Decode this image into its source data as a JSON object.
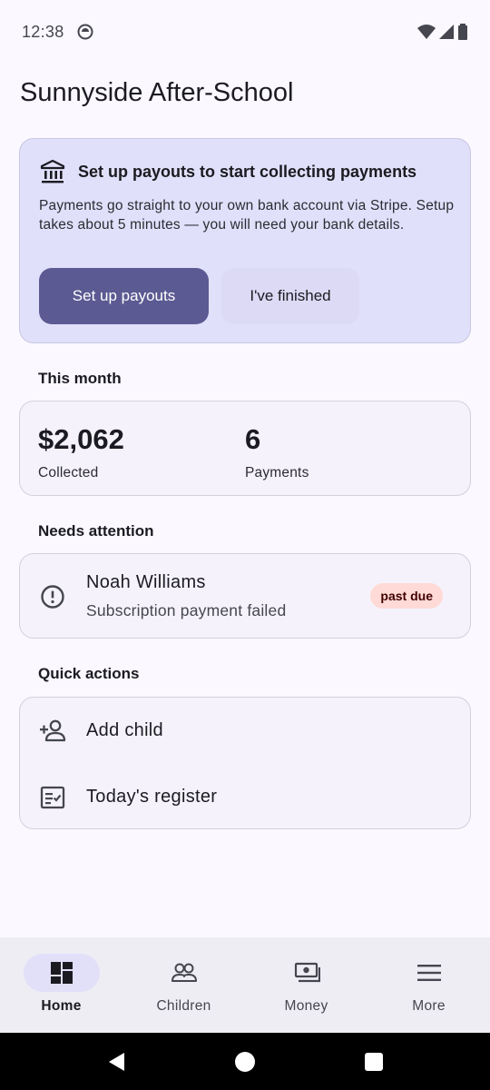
{
  "status_bar": {
    "time": "12:38"
  },
  "app": {
    "title": "Sunnyside After-School"
  },
  "payout_card": {
    "icon": "bank-icon",
    "title": "Set up payouts to start collecting payments",
    "description": "Payments go straight to your own bank account via Stripe. Setup takes about 5 minutes — you will need your bank details.",
    "primary_button": "Set up payouts",
    "secondary_button": "I've finished"
  },
  "this_month": {
    "label": "This month",
    "collected_value": "$2,062",
    "collected_label": "Collected",
    "payments_value": "6",
    "payments_label": "Payments"
  },
  "needs_attention": {
    "label": "Needs attention",
    "items": [
      {
        "name": "Noah Williams",
        "detail": "Subscription payment failed",
        "badge": "past due",
        "icon": "alert-circle-icon"
      }
    ]
  },
  "quick_actions": {
    "label": "Quick actions",
    "items": [
      {
        "label": "Add child",
        "icon": "person-add-icon"
      },
      {
        "label": "Today's register",
        "icon": "checklist-icon"
      }
    ]
  },
  "bottom_nav": {
    "active": "Home",
    "items": [
      {
        "label": "Home",
        "icon": "dashboard-icon"
      },
      {
        "label": "Children",
        "icon": "group-icon"
      },
      {
        "label": "Money",
        "icon": "payments-icon"
      },
      {
        "label": "More",
        "icon": "menu-icon"
      }
    ]
  },
  "colors": {
    "primary": "#5b5a92",
    "card_tint": "#e1e0fb",
    "badge_bg": "#ffdad6",
    "background": "#fbf8ff"
  }
}
